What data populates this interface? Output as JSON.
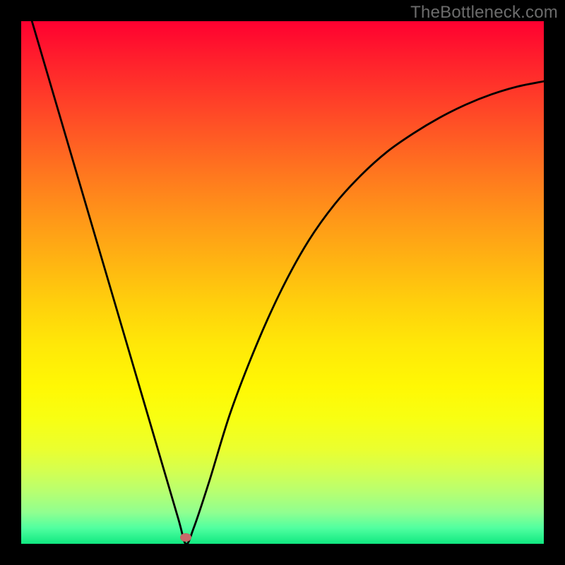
{
  "watermark": "TheBottleneck.com",
  "chart_data": {
    "type": "line",
    "title": "",
    "xlabel": "",
    "ylabel": "",
    "xlim": [
      0,
      1
    ],
    "ylim": [
      0,
      1
    ],
    "grid": false,
    "legend": false,
    "annotations": [],
    "marker": {
      "x": 0.315,
      "y": 0.012
    },
    "series": [
      {
        "name": "curve",
        "x": [
          0.0,
          0.05,
          0.1,
          0.15,
          0.2,
          0.25,
          0.3,
          0.315,
          0.33,
          0.36,
          0.4,
          0.45,
          0.5,
          0.55,
          0.6,
          0.65,
          0.7,
          0.75,
          0.8,
          0.85,
          0.9,
          0.95,
          1.0
        ],
        "y": [
          1.07,
          0.9,
          0.73,
          0.56,
          0.39,
          0.22,
          0.05,
          0.0,
          0.03,
          0.12,
          0.25,
          0.38,
          0.49,
          0.58,
          0.65,
          0.705,
          0.75,
          0.785,
          0.815,
          0.84,
          0.86,
          0.875,
          0.885
        ]
      }
    ],
    "background_gradient": {
      "type": "vertical",
      "stops": [
        {
          "pos": 0.0,
          "color": "#ff0030"
        },
        {
          "pos": 0.25,
          "color": "#ff7a1e"
        },
        {
          "pos": 0.55,
          "color": "#ffd80a"
        },
        {
          "pos": 0.8,
          "color": "#eaff30"
        },
        {
          "pos": 1.0,
          "color": "#10e880"
        }
      ]
    }
  }
}
